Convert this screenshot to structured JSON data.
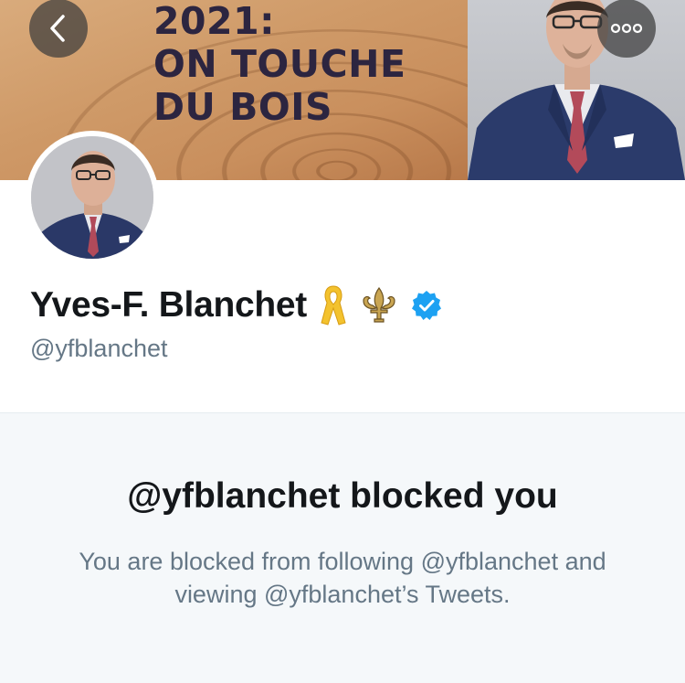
{
  "banner": {
    "headline_lines": [
      "2021:",
      "ON TOUCHE",
      "DU BOIS"
    ]
  },
  "header": {
    "back_icon": "chevron-left-icon",
    "more_icon": "more-horizontal-icon"
  },
  "profile": {
    "display_name": "Yves-F. Blanchet",
    "handle": "@yfblanchet",
    "badges": [
      "yellow-ribbon-icon",
      "fleur-de-lis-icon",
      "verified-badge-icon"
    ],
    "verified_color": "#1da1f2"
  },
  "blocked": {
    "title": "@yfblanchet blocked you",
    "description": "You are blocked from following @yfblanchet and viewing @yfblanchet’s Tweets."
  }
}
